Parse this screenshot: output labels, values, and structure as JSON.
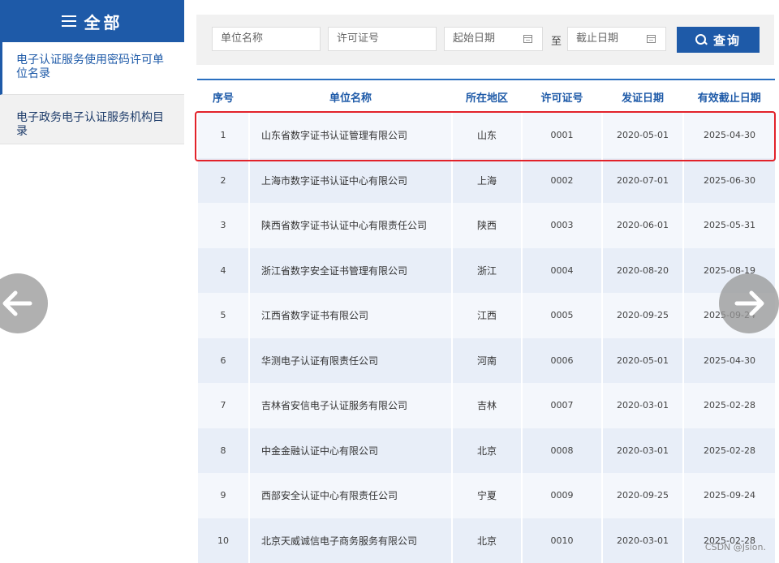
{
  "sidebar": {
    "header_label": "全部",
    "items": [
      {
        "label": "电子认证服务使用密码许可单位名录"
      },
      {
        "label": "电子政务电子认证服务机构目录"
      }
    ]
  },
  "filters": {
    "unit_name_placeholder": "单位名称",
    "license_placeholder": "许可证号",
    "start_date_placeholder": "起始日期",
    "to_label": "至",
    "end_date_placeholder": "截止日期",
    "search_label": "查询"
  },
  "table": {
    "headers": [
      "序号",
      "单位名称",
      "所在地区",
      "许可证号",
      "发证日期",
      "有效截止日期"
    ],
    "rows": [
      {
        "no": "1",
        "name": "山东省数字证书认证管理有限公司",
        "region": "山东",
        "license": "0001",
        "issue": "2020-05-01",
        "expire": "2025-04-30"
      },
      {
        "no": "2",
        "name": "上海市数字证书认证中心有限公司",
        "region": "上海",
        "license": "0002",
        "issue": "2020-07-01",
        "expire": "2025-06-30"
      },
      {
        "no": "3",
        "name": "陕西省数字证书认证中心有限责任公司",
        "region": "陕西",
        "license": "0003",
        "issue": "2020-06-01",
        "expire": "2025-05-31"
      },
      {
        "no": "4",
        "name": "浙江省数字安全证书管理有限公司",
        "region": "浙江",
        "license": "0004",
        "issue": "2020-08-20",
        "expire": "2025-08-19"
      },
      {
        "no": "5",
        "name": "江西省数字证书有限公司",
        "region": "江西",
        "license": "0005",
        "issue": "2020-09-25",
        "expire": "2025-09-24"
      },
      {
        "no": "6",
        "name": "华测电子认证有限责任公司",
        "region": "河南",
        "license": "0006",
        "issue": "2020-05-01",
        "expire": "2025-04-30"
      },
      {
        "no": "7",
        "name": "吉林省安信电子认证服务有限公司",
        "region": "吉林",
        "license": "0007",
        "issue": "2020-03-01",
        "expire": "2025-02-28"
      },
      {
        "no": "8",
        "name": "中金金融认证中心有限公司",
        "region": "北京",
        "license": "0008",
        "issue": "2020-03-01",
        "expire": "2025-02-28"
      },
      {
        "no": "9",
        "name": "西部安全认证中心有限责任公司",
        "region": "宁夏",
        "license": "0009",
        "issue": "2020-09-25",
        "expire": "2025-09-24"
      },
      {
        "no": "10",
        "name": "北京天威诚信电子商务服务有限公司",
        "region": "北京",
        "license": "0010",
        "issue": "2020-03-01",
        "expire": "2025-02-28"
      }
    ]
  },
  "watermark": "CSDN @Jsion.",
  "colors": {
    "accent": "#1e5aa8",
    "highlight": "#e2222a"
  },
  "icons": {
    "menu": "menu-icon",
    "search": "search-icon",
    "calendar": "calendar-icon",
    "prev": "arrow-left-icon",
    "next": "arrow-right-icon"
  }
}
